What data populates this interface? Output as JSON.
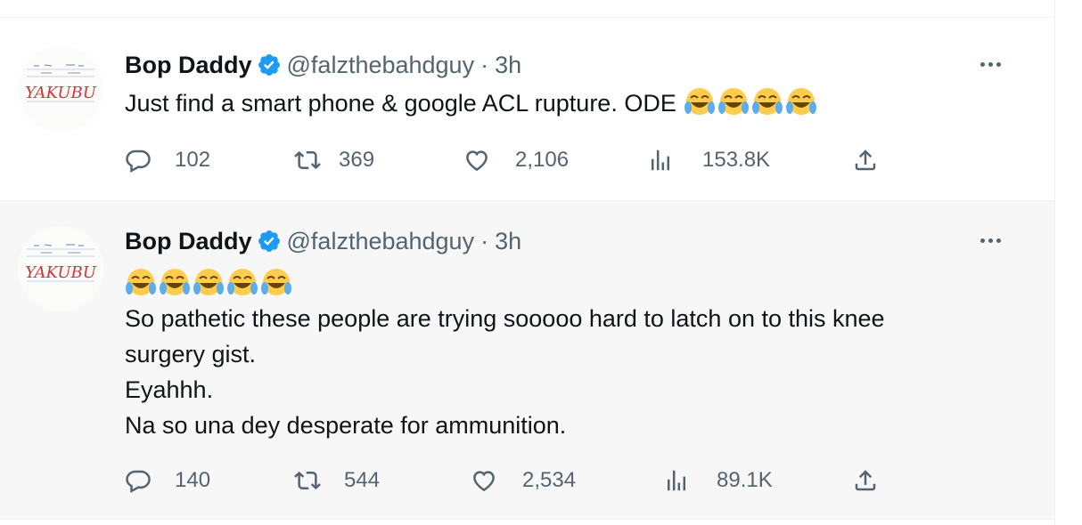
{
  "colors": {
    "verified": "#1d9bf0",
    "secondary_text": "#536471",
    "primary_text": "#0f1419",
    "selected_bg": "#f7f7f7"
  },
  "tweets": [
    {
      "author": {
        "name": "Bop Daddy",
        "handle": "@falzthebahdguy",
        "time": "3h",
        "verified": true,
        "avatar_text": "YAKUBU"
      },
      "text_lines": [
        "Just find a smart phone & google ACL rupture. ODE"
      ],
      "trailing_emoji": [
        "face-with-tears-of-joy",
        "face-with-tears-of-joy",
        "face-with-tears-of-joy",
        "face-with-tears-of-joy"
      ],
      "stats": {
        "replies": "102",
        "reposts": "369",
        "likes": "2,106",
        "views": "153.8K"
      }
    },
    {
      "author": {
        "name": "Bop Daddy",
        "handle": "@falzthebahdguy",
        "time": "3h",
        "verified": true,
        "avatar_text": "YAKUBU"
      },
      "leading_emoji": [
        "face-with-tears-of-joy",
        "face-with-tears-of-joy",
        "face-with-tears-of-joy",
        "face-with-tears-of-joy",
        "face-with-tears-of-joy"
      ],
      "text_lines": [
        "So pathetic these people are trying sooooo hard to latch on to this knee",
        "surgery gist.",
        "Eyahhh.",
        "Na so una dey desperate for ammunition."
      ],
      "stats": {
        "replies": "140",
        "reposts": "544",
        "likes": "2,534",
        "views": "89.1K"
      }
    }
  ]
}
